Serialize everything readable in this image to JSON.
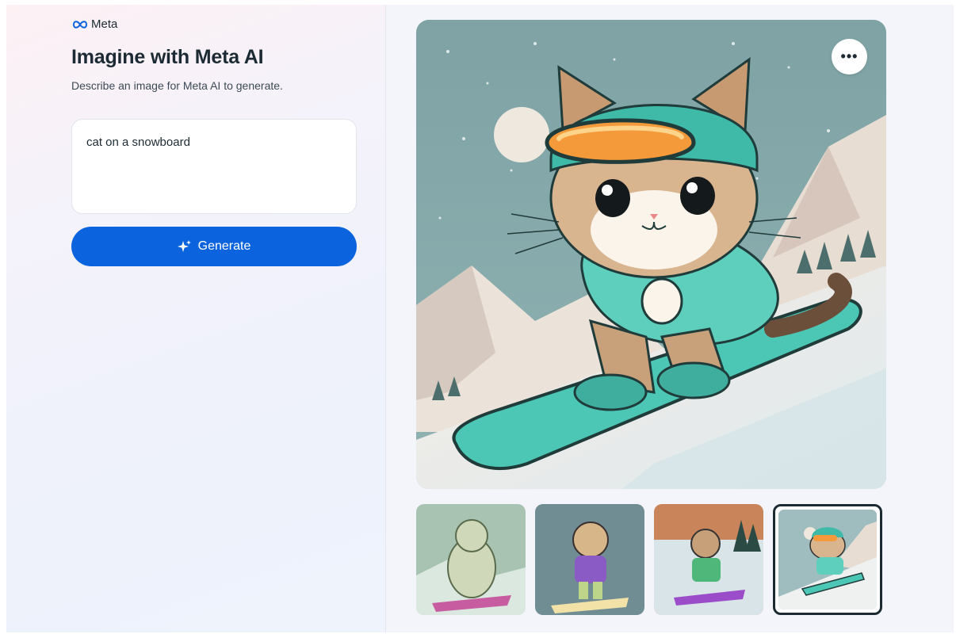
{
  "brand": {
    "name": "Meta",
    "logo_icon": "meta-infinity-logo-icon"
  },
  "header": {
    "title": "Imagine with Meta AI",
    "subtitle": "Describe an image for Meta AI to generate."
  },
  "prompt": {
    "value": "cat on a snowboard"
  },
  "generate_button": {
    "label": "Generate",
    "icon": "sparkle-icon"
  },
  "main_image": {
    "more_icon": "more-horizontal-icon",
    "more_label": "•••"
  },
  "thumbnails": {
    "count": 4,
    "selected_index": 3
  },
  "colors": {
    "accent": "#0b64dd",
    "text": "#1c2b33",
    "sky": "#7ea4a6",
    "snowboard": "#4cc7b5",
    "helmet": "#3fb9a8",
    "goggles": "#f49a3a"
  }
}
